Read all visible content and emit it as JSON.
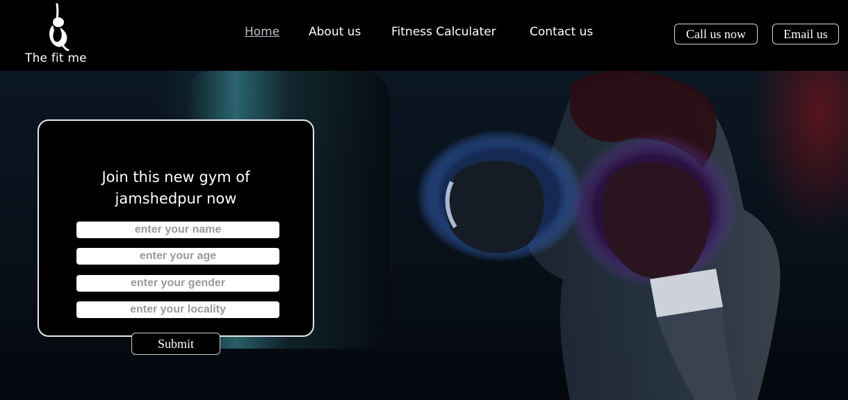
{
  "brand": {
    "name": "The fit me",
    "logo_icon": "yoga-figure-icon",
    "color": "#ffffff"
  },
  "nav": {
    "items": [
      {
        "label": "Home",
        "active": true
      },
      {
        "label": "About us",
        "active": false
      },
      {
        "label": "Fitness Calculater",
        "active": false
      },
      {
        "label": "Contact us",
        "active": false
      }
    ]
  },
  "header_actions": {
    "call_label": "Call us now",
    "email_label": "Email us"
  },
  "hero": {
    "image": "boxer-with-punching-bag"
  },
  "form": {
    "title_line1": "Join this new gym of",
    "title_line2": "jamshedpur now",
    "name_placeholder": "enter your name",
    "age_placeholder": "enter your age",
    "gender_placeholder": "enter your gender",
    "locality_placeholder": "enter your locality",
    "submit_label": "Submit"
  },
  "colors": {
    "header_bg": "#000000",
    "active_nav": "#b9c3cc",
    "form_border": "#e9e9e9"
  }
}
